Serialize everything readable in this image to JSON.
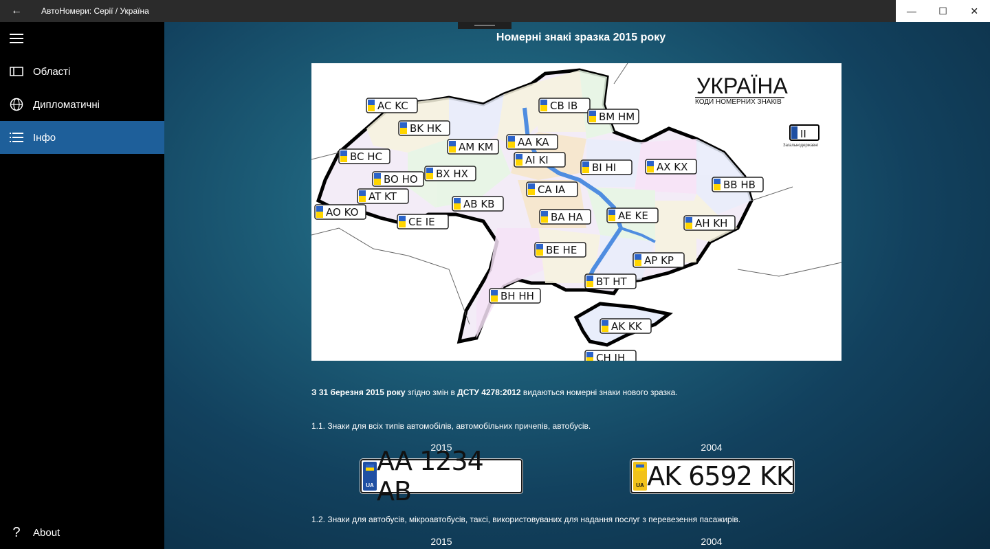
{
  "window": {
    "title": "АвтоНомери: Серії / Україна"
  },
  "sidebar": {
    "items": [
      {
        "label": "Області"
      },
      {
        "label": "Дипломатичні"
      },
      {
        "label": "Інфо"
      }
    ],
    "about_label": "About"
  },
  "main": {
    "title": "Номерні знакі зразка 2015 року",
    "map": {
      "heading": "УКРАЇНА",
      "subheading": "КОДИ НОМЕРНИХ ЗНАКІВ",
      "legend_code": "II",
      "legend_caption": "Загальнодержавні",
      "codes": [
        "AC KC",
        "BK HK",
        "BC HC",
        "AM KM",
        "AA KA",
        "CB IB",
        "BM HM",
        "AI KI",
        "BI HI",
        "AX KX",
        "BB HB",
        "BO HO",
        "BX HX",
        "AT KT",
        "CA IA",
        "AO KO",
        "AB KB",
        "CE IE",
        "BA HA",
        "AE KE",
        "AH KH",
        "BE HE",
        "AP KP",
        "BT HT",
        "BH HH",
        "AK KK",
        "CH IH"
      ]
    },
    "intro": {
      "date": "З 31 березня 2015 року",
      "mid": " згідно змін в ",
      "standard": "ДСТУ 4278:2012",
      "tail": " видаються номерні знаки нового зразка."
    },
    "section1": "1.1. Знаки для всіх типів автомобілів, автомобільних причепів, автобусів.",
    "section2": "1.2. Знаки для автобусів, мікроавтобусів, таксі, використовуваних для надання послуг з перевезення пасажирів.",
    "year_new": "2015",
    "year_old": "2004",
    "plate_new": "AA 1234 AB",
    "plate_old": "AK 6592 KK",
    "plate_ua": "UA"
  },
  "colors": {
    "accent": "#1e5f9a",
    "sidebar_bg": "#000000",
    "titlebar_bg": "#2b2b2b"
  }
}
